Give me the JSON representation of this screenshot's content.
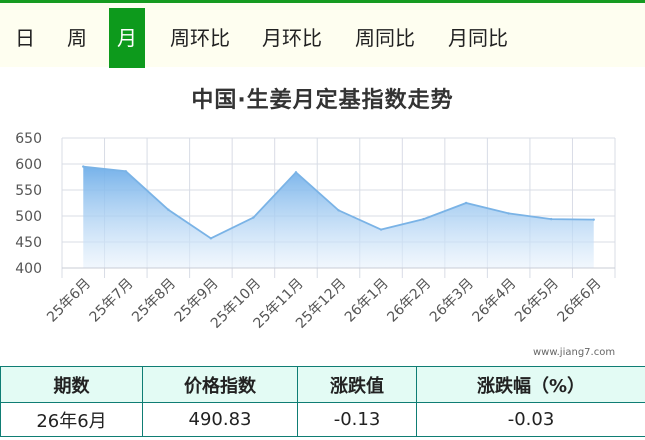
{
  "tabs": [
    {
      "label": "日",
      "active": false
    },
    {
      "label": "周",
      "active": false
    },
    {
      "label": "月",
      "active": true
    },
    {
      "label": "周环比",
      "active": false
    },
    {
      "label": "月环比",
      "active": false
    },
    {
      "label": "周同比",
      "active": false
    },
    {
      "label": "月同比",
      "active": false
    }
  ],
  "watermark": "www.jiang7.com",
  "table": {
    "headers": [
      "期数",
      "价格指数",
      "涨跌值",
      "涨跌幅（%）"
    ],
    "row": [
      "26年6月",
      "490.83",
      "-0.13",
      "-0.03"
    ]
  },
  "colors": {
    "tab_active": "#0d9a1c",
    "line": "#7ab3e6",
    "area_top": "#7fb6ec",
    "grid": "#d8dce6",
    "table_border": "#0f7d74"
  },
  "chart_data": {
    "type": "area",
    "title": "中国·生姜月定基指数走势",
    "categories": [
      "25年6月",
      "25年7月",
      "25年8月",
      "25年9月",
      "25年10月",
      "25年11月",
      "25年12月",
      "26年1月",
      "26年2月",
      "26年3月",
      "26年4月",
      "26年5月",
      "26年6月"
    ],
    "series": [
      {
        "values": [
          595,
          586,
          512,
          457,
          497,
          584,
          511,
          474,
          494,
          525,
          505,
          494,
          493
        ]
      }
    ],
    "ylim": [
      400,
      650
    ],
    "yticks": [
      400,
      450,
      500,
      550,
      600,
      650
    ],
    "xlabel": "",
    "ylabel": "",
    "grid": true,
    "legend": "none"
  }
}
